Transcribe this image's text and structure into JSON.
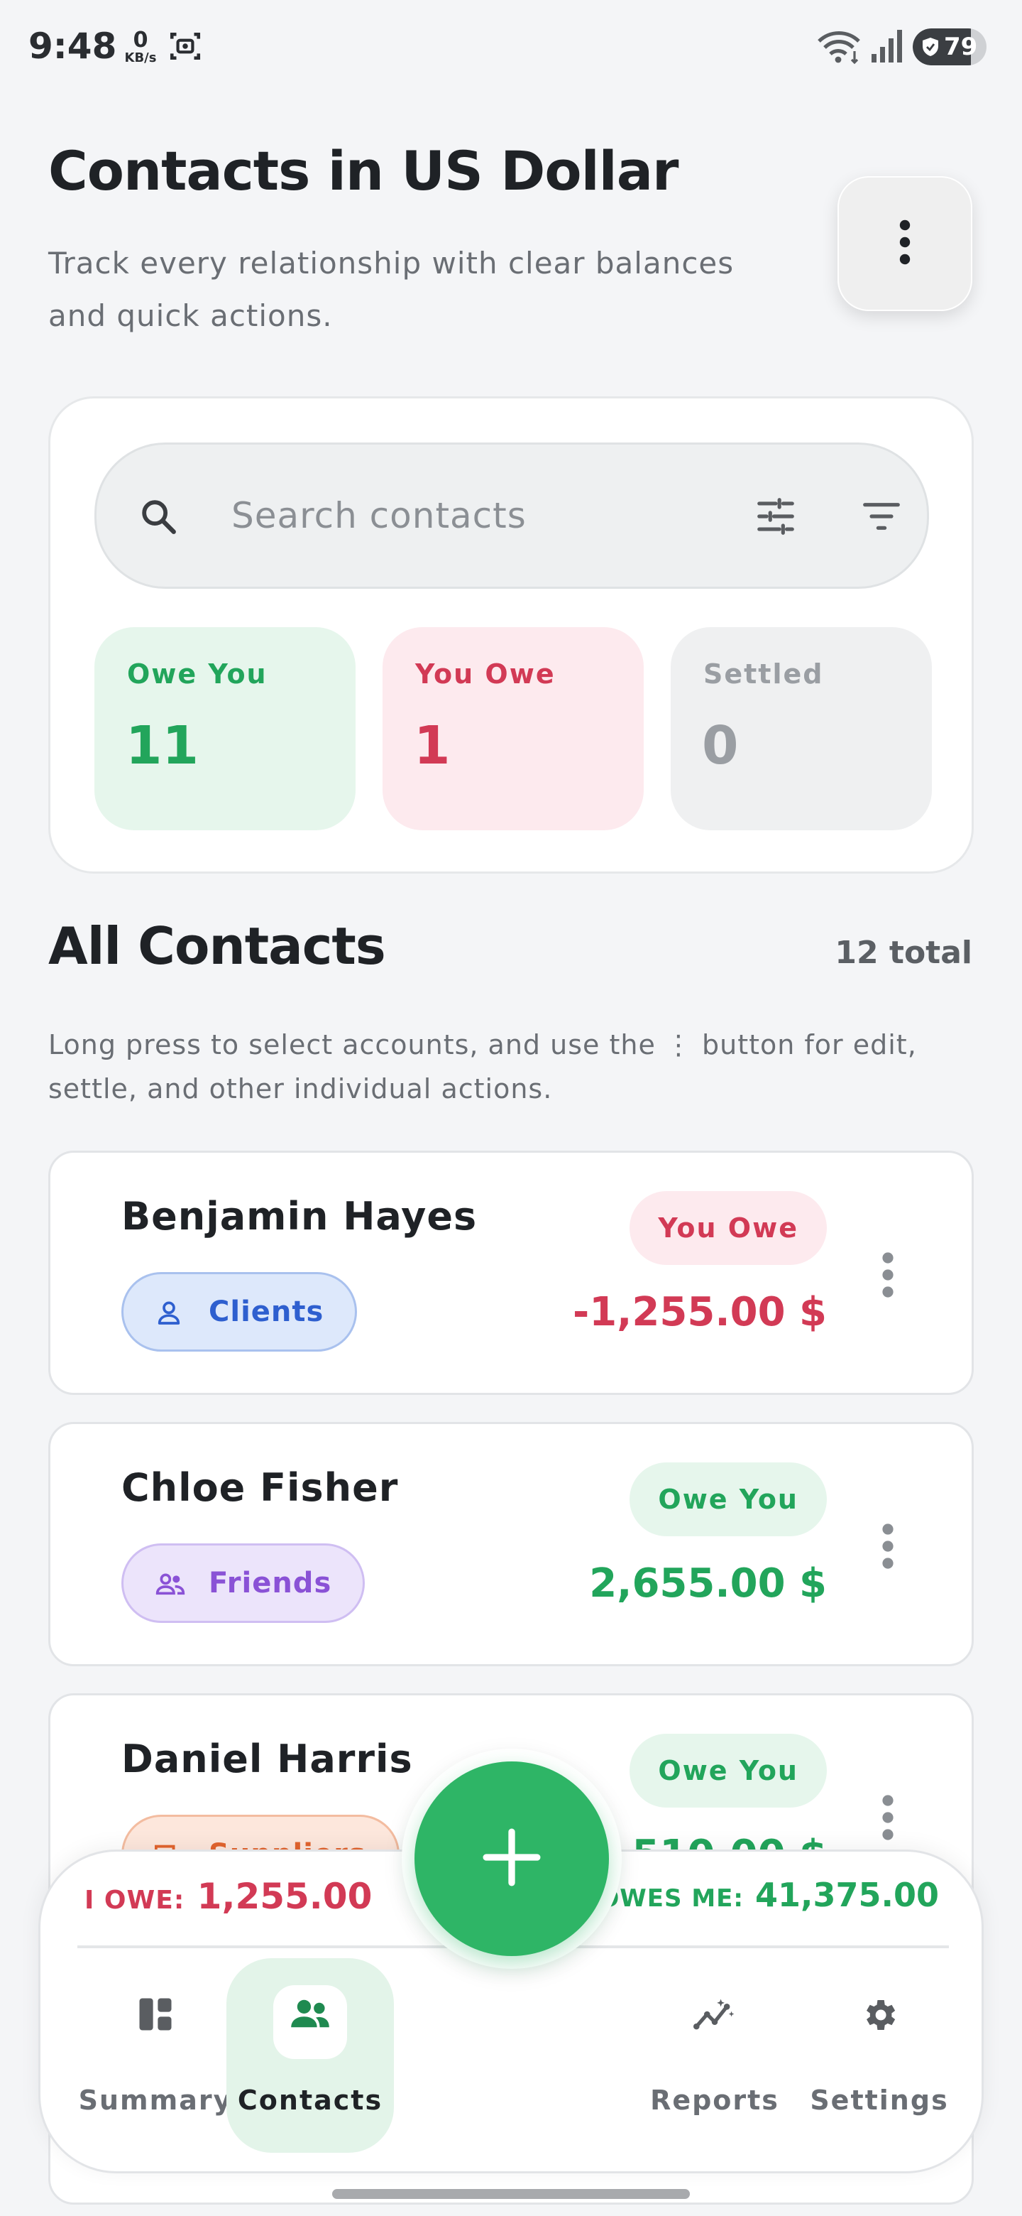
{
  "status_bar": {
    "time": "9:48",
    "net_speed": "0",
    "net_unit": "KB/s",
    "battery": "79",
    "battery_level": 0.79
  },
  "header": {
    "title": "Contacts in US Dollar",
    "subtitle": "Track every relationship with clear balances and quick actions.",
    "more_icon": "more-vert-icon"
  },
  "search": {
    "placeholder": "Search contacts",
    "value": "",
    "icons": [
      "search-icon",
      "tune-icon",
      "filter-icon"
    ]
  },
  "stats": [
    {
      "label": "Owe You",
      "value": "11",
      "color": "#22a55b"
    },
    {
      "label": "You Owe",
      "value": "1",
      "color": "#d23a55"
    },
    {
      "label": "Settled",
      "value": "0",
      "color": "#9a9ea3"
    }
  ],
  "section": {
    "title": "All Contacts",
    "count": "12 total",
    "hint": "Long press to select accounts, and use the ⋮ button for edit, settle, and other individual actions."
  },
  "contacts": [
    {
      "name": "Benjamin Hayes",
      "tag": "Clients",
      "tag_icon": "person-icon",
      "status": "You Owe",
      "amount": "-1,255.00 $"
    },
    {
      "name": "Chloe Fisher",
      "tag": "Friends",
      "tag_icon": "group-icon",
      "status": "Owe You",
      "amount": "2,655.00 $"
    },
    {
      "name": "Daniel Harris",
      "tag": "Suppliers",
      "tag_icon": "truck-icon",
      "status": "Owe You",
      "amount": "4,510.00 $"
    }
  ],
  "totals": {
    "iowe_label": "I OWE:",
    "iowe_value": "1,255.00",
    "owesme_label": "OWES ME:",
    "owesme_value": "41,375.00"
  },
  "nav": {
    "items": [
      {
        "label": "Summary",
        "icon": "dashboard-icon"
      },
      {
        "label": "Contacts",
        "icon": "contacts-icon",
        "active": true
      },
      {
        "label": "Reports",
        "icon": "insights-icon"
      },
      {
        "label": "Settings",
        "icon": "gear-icon"
      }
    ],
    "fab_icon": "plus-icon"
  },
  "colors": {
    "accent_green": "#2eb566",
    "positive": "#22a55b",
    "negative": "#d23a55"
  }
}
